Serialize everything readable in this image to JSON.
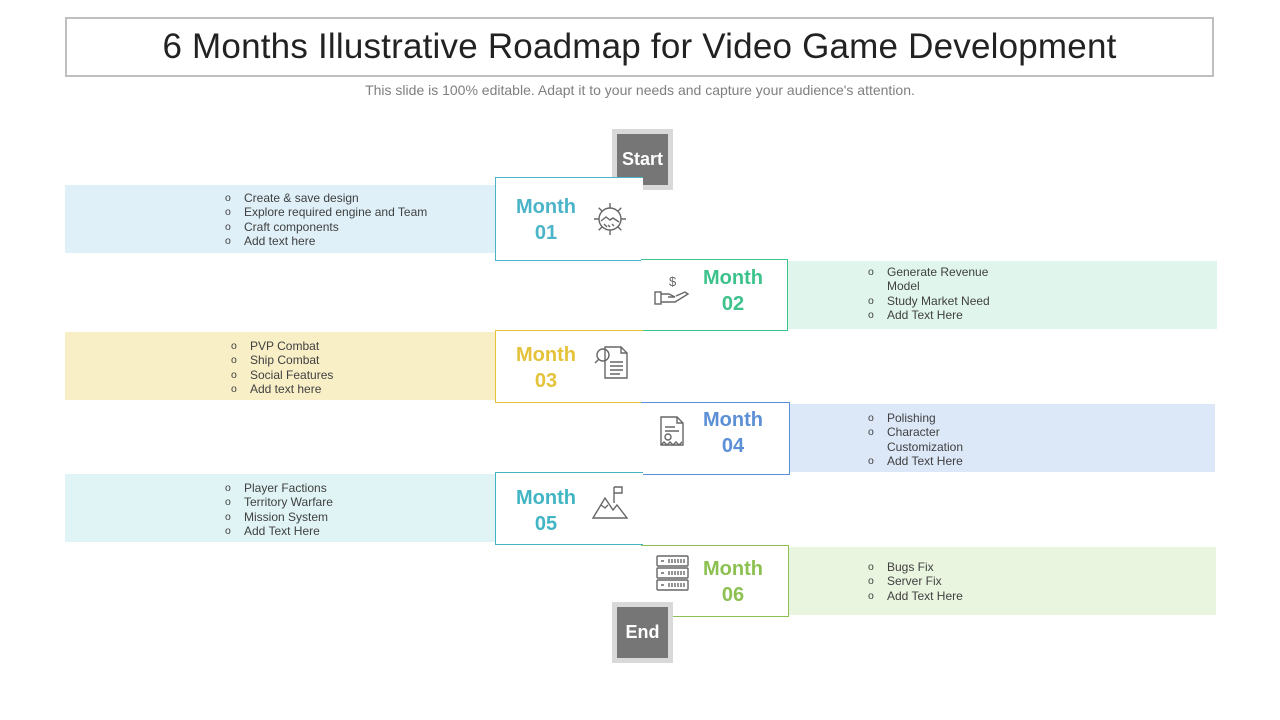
{
  "title": "6 Months Illustrative Roadmap for Video Game Development",
  "subtitle": "This slide is 100% editable. Adapt it to your needs and capture your audience's attention.",
  "start_label": "Start",
  "end_label": "End",
  "months": [
    {
      "word": "Month",
      "num": "01",
      "color": "#4bb4c9",
      "band": "#dff0f8",
      "icon": "gear-handshake-icon",
      "items": [
        "Create & save design",
        "Explore required engine and Team",
        "Craft components",
        "Add text here"
      ]
    },
    {
      "word": "Month",
      "num": "02",
      "color": "#3ec28c",
      "band": "#e0f6ed",
      "icon": "hand-dollar-icon",
      "items": [
        "Generate Revenue Model",
        "Study Market Need",
        "Add Text Here"
      ]
    },
    {
      "word": "Month",
      "num": "03",
      "color": "#e4c23a",
      "band": "#f8efc7",
      "icon": "document-search-icon",
      "items": [
        "PVP Combat",
        "Ship Combat",
        "Social Features",
        "Add text here"
      ]
    },
    {
      "word": "Month",
      "num": "04",
      "color": "#5b8fd6",
      "band": "#dce7f8",
      "icon": "certificate-icon",
      "items": [
        "Polishing",
        "Character Customization",
        "Add Text Here"
      ]
    },
    {
      "word": "Month",
      "num": "05",
      "color": "#42b5c4",
      "band": "#e0f4f5",
      "icon": "mountain-flag-icon",
      "items": [
        "Player Factions",
        "Territory Warfare",
        "Mission System",
        "Add Text Here"
      ]
    },
    {
      "word": "Month",
      "num": "06",
      "color": "#8cc152",
      "band": "#eaf5df",
      "icon": "server-icon",
      "items": [
        "Bugs Fix",
        "Server Fix",
        "Add Text Here"
      ]
    }
  ]
}
